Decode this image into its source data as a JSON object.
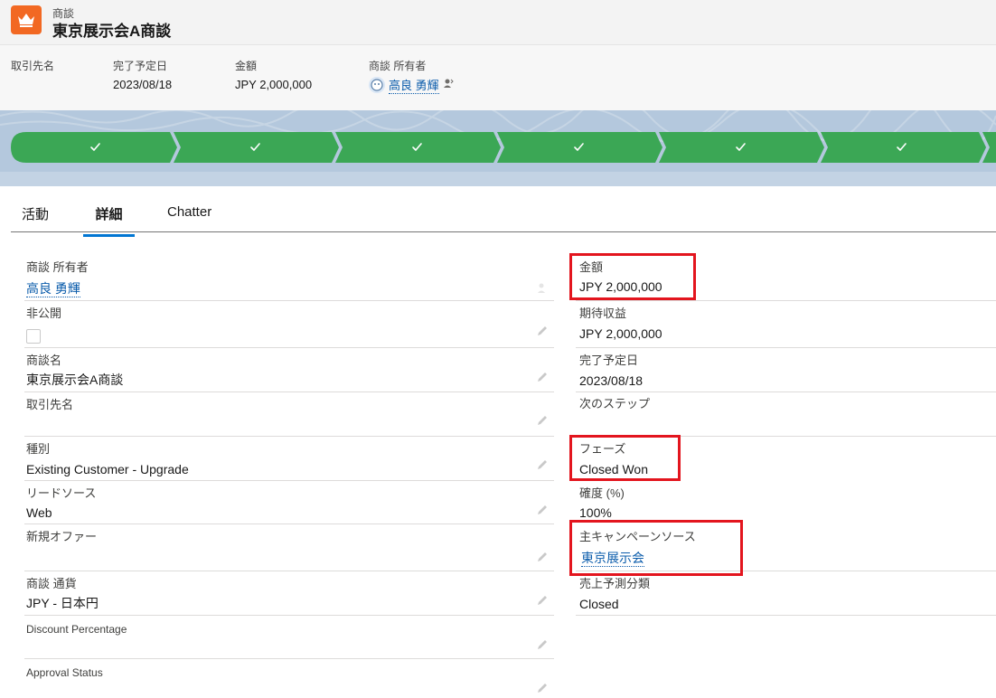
{
  "header": {
    "object_label": "商談",
    "record_title": "東京展示会A商談",
    "icon": "crown-icon"
  },
  "highlights": [
    {
      "label": "取引先名",
      "value": ""
    },
    {
      "label": "完了予定日",
      "value": "2023/08/18"
    },
    {
      "label": "金額",
      "value": "JPY 2,000,000"
    },
    {
      "label": "商談 所有者",
      "value": "高良 勇輝"
    }
  ],
  "path": {
    "steps_completed": 7,
    "color": "#3ba755",
    "icon": "check-icon"
  },
  "tabs": [
    "活動",
    "詳細",
    "Chatter"
  ],
  "active_tab": "詳細",
  "left_fields": [
    {
      "label": "商談 所有者",
      "value": "高良 勇輝"
    },
    {
      "label": "非公開",
      "value": ""
    },
    {
      "label": "商談名",
      "value": "東京展示会A商談"
    },
    {
      "label": "取引先名",
      "value": ""
    },
    {
      "label": "種別",
      "value": "Existing Customer - Upgrade"
    },
    {
      "label": "リードソース",
      "value": "Web"
    },
    {
      "label": "新規オファー",
      "value": ""
    },
    {
      "label": "商談 通貨",
      "value": "JPY - 日本円"
    },
    {
      "label": "Discount Percentage",
      "value": ""
    },
    {
      "label": "Approval Status",
      "value": ""
    }
  ],
  "right_fields": [
    {
      "label": "金額",
      "value": "JPY 2,000,000"
    },
    {
      "label": "期待収益",
      "value": "JPY 2,000,000"
    },
    {
      "label": "完了予定日",
      "value": "2023/08/18"
    },
    {
      "label": "次のステップ",
      "value": ""
    },
    {
      "label": "フェーズ",
      "value": "Closed Won"
    },
    {
      "label": "確度 (%)",
      "value": "100%"
    },
    {
      "label": "主キャンペーンソース",
      "value": "東京展示会"
    },
    {
      "label": "売上予測分類",
      "value": "Closed"
    }
  ],
  "colors": {
    "accent": "#0176d3",
    "link": "#0b5cab",
    "highlight_border": "#e3151e",
    "icon_bg": "#f26822"
  }
}
